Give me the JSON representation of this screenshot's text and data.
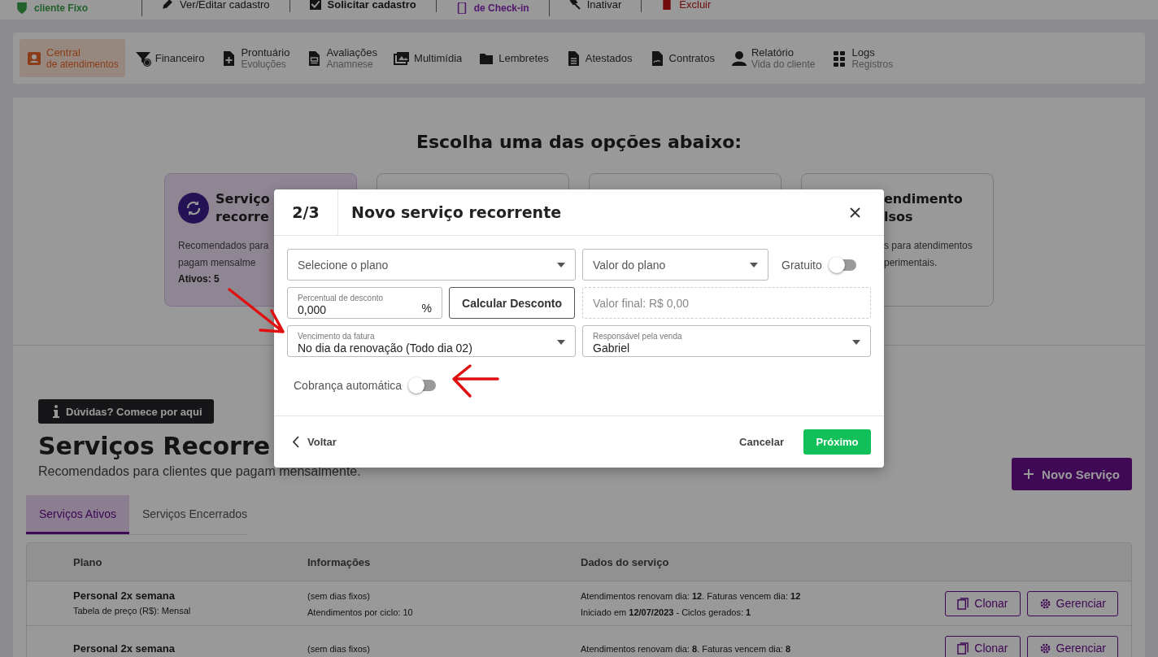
{
  "top_bar": {
    "items": [
      {
        "label": "cliente Fixo",
        "kind": "status"
      },
      {
        "label": "Ver/Editar cadastro",
        "kind": "edit"
      },
      {
        "label": "Solicitar cadastro",
        "kind": "request"
      },
      {
        "label": "de Check-in",
        "kind": "checkin"
      },
      {
        "label": "Inativar",
        "kind": "deactivate"
      },
      {
        "label": "Excluir",
        "kind": "delete"
      }
    ]
  },
  "nav": {
    "items": [
      {
        "label": "Central",
        "sublabel": "de atendimentos",
        "selected": true
      },
      {
        "label": "Financeiro",
        "selected": false
      },
      {
        "label": "Prontuário",
        "sublabel": "Evoluções",
        "selected": false
      },
      {
        "label": "Avaliações",
        "sublabel": "Anamnese",
        "selected": false
      },
      {
        "label": "Multimídia",
        "selected": false
      },
      {
        "label": "Lembretes",
        "selected": false
      },
      {
        "label": "Atestados",
        "selected": false
      },
      {
        "label": "Contratos",
        "selected": false
      },
      {
        "label": "Relatório",
        "sublabel": "Vida do cliente",
        "selected": false
      },
      {
        "label": "Logs",
        "sublabel": "Registros",
        "selected": false
      }
    ]
  },
  "options": {
    "heading": "Escolha uma das opções abaixo:",
    "cards": [
      {
        "selected": true,
        "title_lines": [
          "Serviço",
          "recorre"
        ],
        "description_lines": [
          "Recomendados para",
          "pagam mensalme"
        ],
        "footer": "Ativos: 5"
      },
      {
        "selected": false
      },
      {
        "selected": false
      },
      {
        "selected": false,
        "title_lines": [
          "endimento",
          "lsos"
        ],
        "description_lines": [
          "s para atendimentos",
          "perimentais."
        ]
      }
    ]
  },
  "section": {
    "help_button": "Dúvidas? Comece por aqui",
    "title": "Serviços Recorre",
    "subtitle": "Recomendados para clientes que pagam mensalmente.",
    "new_button": "Novo Serviço",
    "tabs": [
      {
        "label": "Serviços Ativos",
        "selected": true
      },
      {
        "label": "Serviços Encerrados",
        "selected": false
      }
    ],
    "table": {
      "columns": [
        "Plano",
        "Informações",
        "Dados do serviço"
      ],
      "rows": [
        {
          "plan": "Personal 2x semana",
          "price_table": "Tabela de preço (R$): Mensal",
          "info": [
            "(sem dias fixos)",
            "Atendimentos por ciclo: 10"
          ],
          "data": [
            "Atendimentos renovam dia: **12**. Faturas vencem dia: **12**",
            "Iniciado em **12/07/2023** - Ciclos gerados: **1**"
          ],
          "actions": [
            "Clonar",
            "Gerenciar"
          ]
        },
        {
          "plan": "Personal 2x semana",
          "info": [
            "(sem dias fixos)"
          ],
          "data": [
            "Atendimentos renovam dia: **8**. Faturas vencem dia: **8**"
          ],
          "actions": [
            "Clonar",
            "Gerenciar"
          ]
        }
      ]
    }
  },
  "modal": {
    "step": "2/3",
    "title": "Novo serviço recorrente",
    "plan_select": {
      "placeholder": "Selecione o plano"
    },
    "value_select": {
      "placeholder": "Valor do plano"
    },
    "free_toggle": {
      "label": "Gratuito",
      "on": false
    },
    "discount": {
      "label": "Percentual de desconto",
      "value": "0,000",
      "suffix": "%"
    },
    "calc_button": "Calcular Desconto",
    "final_value": {
      "placeholder": "Valor final: R$ 0,00"
    },
    "due_select": {
      "label": "Vencimento da fatura",
      "value": "No dia da renovação (Todo dia 02)"
    },
    "seller_select": {
      "label": "Responsável pela venda",
      "value": "Gabriel"
    },
    "auto_charge_toggle": {
      "label": "Cobrança automática",
      "on": false
    },
    "back": "Voltar",
    "cancel": "Cancelar",
    "next": "Próximo"
  }
}
